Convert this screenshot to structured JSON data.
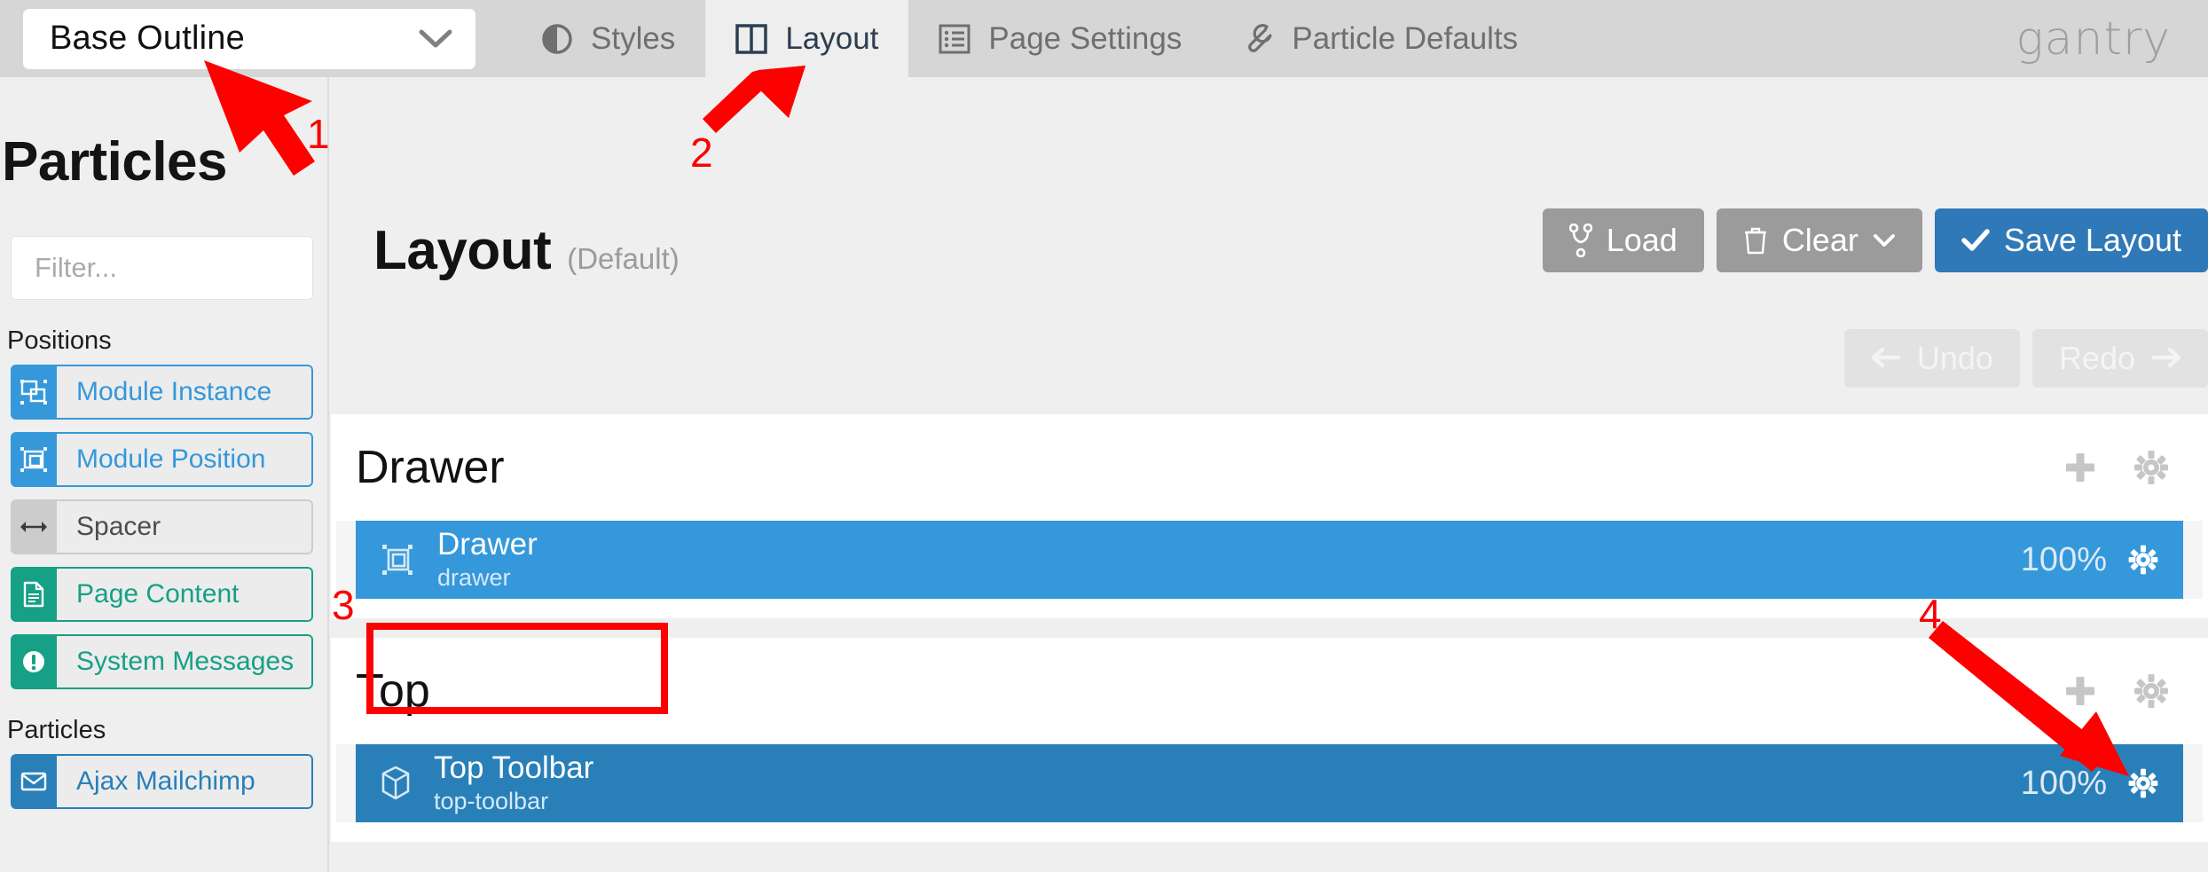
{
  "topbar": {
    "outline_selector": {
      "value": "Base Outline",
      "icon": "chevron-down-icon"
    },
    "tabs": [
      {
        "label": "Styles",
        "icon": "contrast-icon",
        "active": false
      },
      {
        "label": "Layout",
        "icon": "columns-icon",
        "active": true
      },
      {
        "label": "Page Settings",
        "icon": "list-icon",
        "active": false
      },
      {
        "label": "Particle Defaults",
        "icon": "wrench-icon",
        "active": false
      }
    ],
    "brand": "gantry"
  },
  "sidebar": {
    "title": "Particles",
    "filter": {
      "placeholder": "Filter...",
      "value": "",
      "icon": "search-icon"
    },
    "groups": [
      {
        "title": "Positions",
        "items": [
          {
            "label": "Module Instance",
            "icon": "module-instance-icon",
            "color": "#3498db",
            "text_color": "#3498db"
          },
          {
            "label": "Module Position",
            "icon": "module-position-icon",
            "color": "#3498db",
            "text_color": "#3498db"
          },
          {
            "label": "Spacer",
            "icon": "arrows-horizontal-icon",
            "color": "#cccccc",
            "text_color": "#4d4d4d"
          },
          {
            "label": "Page Content",
            "icon": "document-icon",
            "color": "#16a085",
            "text_color": "#16a085"
          },
          {
            "label": "System Messages",
            "icon": "exclamation-icon",
            "color": "#16a085",
            "text_color": "#16a085"
          }
        ]
      },
      {
        "title": "Particles",
        "items": [
          {
            "label": "Ajax Mailchimp",
            "icon": "envelope-icon",
            "color": "#2980b9",
            "text_color": "#2980b9"
          }
        ]
      }
    ]
  },
  "main": {
    "page_title": "Layout",
    "page_subtitle": "(Default)",
    "actions": [
      {
        "label": "Load",
        "icon": "code-fork-icon",
        "style": "grey"
      },
      {
        "label": "Clear",
        "icon": "trash-icon",
        "trailing_icon": "chevron-down-icon",
        "style": "grey"
      },
      {
        "label": "Save Layout",
        "icon": "check-icon",
        "style": "blue"
      }
    ],
    "history": [
      {
        "label": "Undo",
        "icon": "arrow-left-icon",
        "disabled": true
      },
      {
        "label": "Redo",
        "icon": "arrow-right-icon",
        "disabled": true
      }
    ],
    "sections": [
      {
        "name": "Drawer",
        "tools": [
          "plus-icon",
          "gear-icon"
        ],
        "rows": [
          {
            "name": "Drawer",
            "key": "drawer",
            "percent": "100%",
            "icon": "module-position-icon",
            "color": "#3498db",
            "gear": "gear-icon"
          }
        ]
      },
      {
        "name": "Top",
        "tools": [
          "plus-icon",
          "gear-icon"
        ],
        "rows": [
          {
            "name": "Top Toolbar",
            "key": "top-toolbar",
            "percent": "100%",
            "icon": "cube-icon",
            "color": "#2980b9",
            "gear": "gear-icon"
          }
        ]
      }
    ]
  },
  "annotations": {
    "color": "#fd0000",
    "markers": [
      {
        "number": "1",
        "target": "outline-selector"
      },
      {
        "number": "2",
        "target": "layout-tab"
      },
      {
        "number": "3",
        "target": "top-section-title"
      },
      {
        "number": "4",
        "target": "top-toolbar-gear"
      }
    ]
  }
}
